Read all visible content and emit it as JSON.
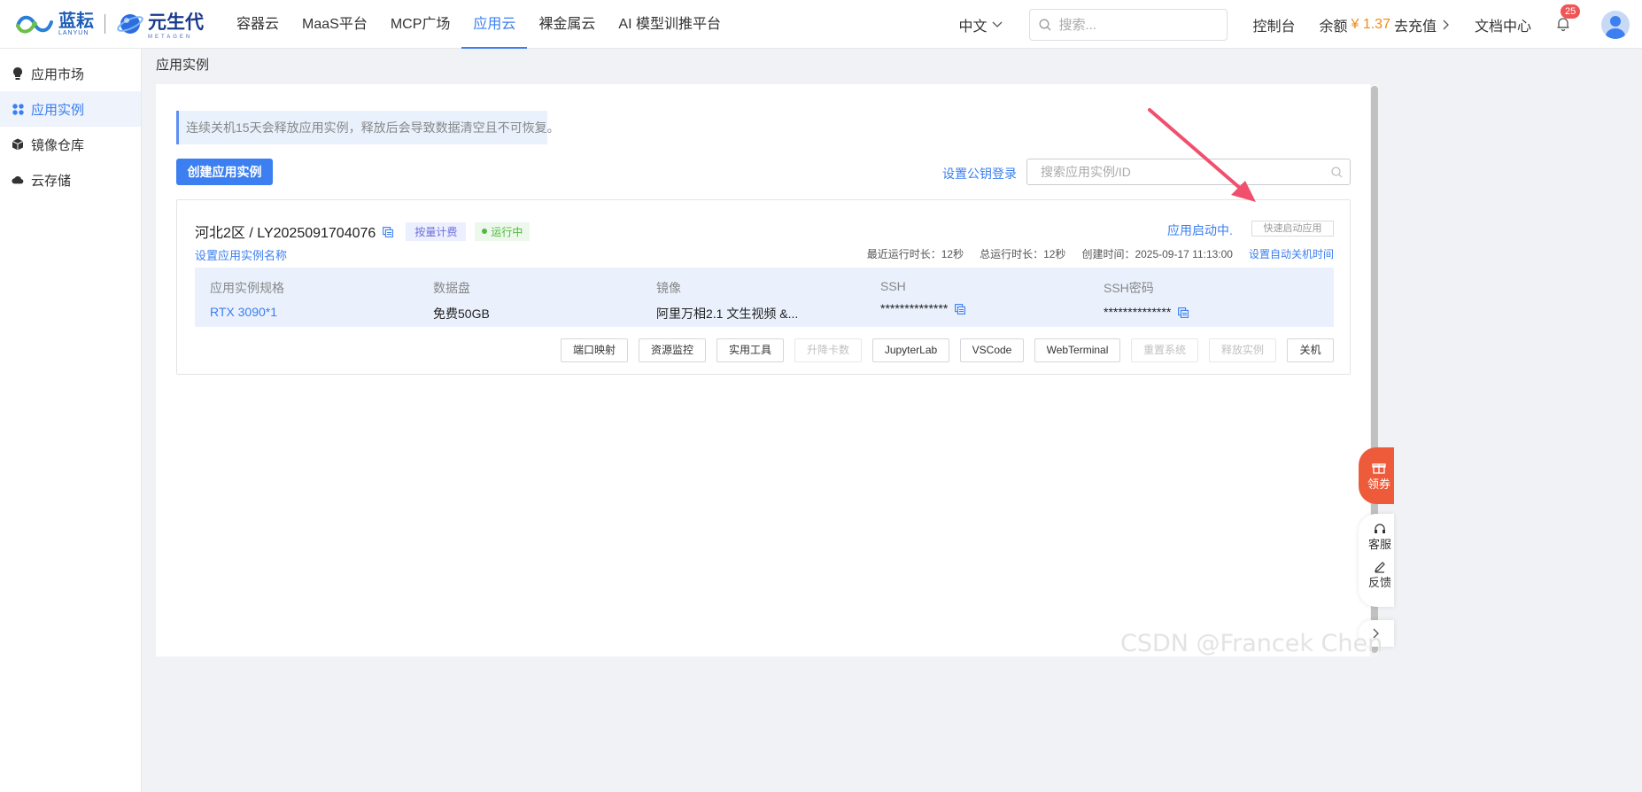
{
  "brand": {
    "logo1_name": "蓝耘",
    "logo1_sub": "LANYUN",
    "logo2_name": "元生代",
    "logo2_sub": "METAGEN"
  },
  "nav": {
    "items": [
      "容器云",
      "MaaS平台",
      "MCP广场",
      "应用云",
      "裸金属云",
      "AI 模型训推平台"
    ],
    "active_index": 3
  },
  "header": {
    "language": "中文",
    "search_placeholder": "搜索...",
    "console": "控制台",
    "balance_label": "余额",
    "balance_amount": "¥ 1.37",
    "recharge": "去充值",
    "docs": "文档中心",
    "notification_count": "25"
  },
  "sidebar": {
    "items": [
      {
        "label": "应用市场",
        "icon": "bulb-icon"
      },
      {
        "label": "应用实例",
        "icon": "grid-icon"
      },
      {
        "label": "镜像仓库",
        "icon": "cube-icon"
      },
      {
        "label": "云存储",
        "icon": "cloud-icon"
      }
    ],
    "active_index": 1
  },
  "page": {
    "breadcrumb": "应用实例",
    "notice": "连续关机15天会释放应用实例，释放后会导致数据清空且不可恢复。",
    "create_button": "创建应用实例",
    "ssh_key_login": "设置公钥登录",
    "search_placeholder": "搜索应用实例/ID"
  },
  "instance": {
    "region_id": "河北2区 / LY2025091704076",
    "billing_tag": "按量计费",
    "status": "运行中",
    "status_color": "#52b83f",
    "starting_text": "应用启动中.",
    "quick_start": "快速启动应用",
    "rename": "设置应用实例名称",
    "recent_runtime": "最近运行时长：12秒",
    "total_runtime": "总运行时长：12秒",
    "created_time": "创建时间：2025-09-17 11:13:00",
    "auto_shutdown": "设置自动关机时间",
    "spec": {
      "spec_label": "应用实例规格",
      "spec_value": "RTX 3090*1",
      "disk_label": "数据盘",
      "disk_value": "免费50GB",
      "image_label": "镜像",
      "image_value": "阿里万相2.1 文生视频 &...",
      "ssh_label": "SSH",
      "ssh_value": "**************",
      "ssh_pwd_label": "SSH密码",
      "ssh_pwd_value": "**************"
    },
    "actions": [
      {
        "label": "端口映射",
        "disabled": false
      },
      {
        "label": "资源监控",
        "disabled": false
      },
      {
        "label": "实用工具",
        "disabled": false
      },
      {
        "label": "升降卡数",
        "disabled": true
      },
      {
        "label": "JupyterLab",
        "disabled": false
      },
      {
        "label": "VSCode",
        "disabled": false
      },
      {
        "label": "WebTerminal",
        "disabled": false
      },
      {
        "label": "重置系统",
        "disabled": true
      },
      {
        "label": "释放实例",
        "disabled": true
      },
      {
        "label": "关机",
        "disabled": false
      }
    ]
  },
  "float": {
    "coupon": "领券",
    "service": "客服",
    "feedback": "反馈"
  },
  "watermark": "CSDN @Francek Chen",
  "colors": {
    "accent": "#3b7ff0",
    "balance": "#f08c1a",
    "annotation_arrow": "#f0506e"
  }
}
